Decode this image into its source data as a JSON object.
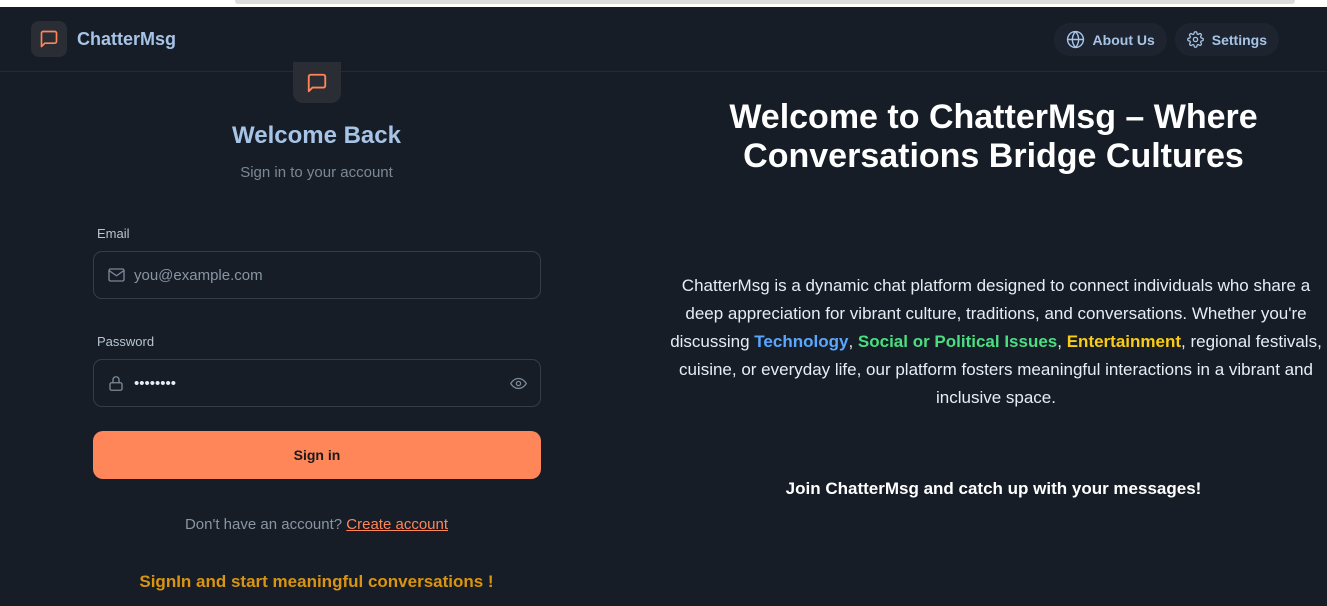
{
  "brand": {
    "name": "ChatterMsg",
    "icon": "chat-bubble-icon",
    "accent": "#fe8659"
  },
  "nav": {
    "about_label": "About Us",
    "about_icon": "globe-icon",
    "settings_label": "Settings",
    "settings_icon": "gear-icon"
  },
  "login": {
    "title": "Welcome Back",
    "subtitle": "Sign in to your account",
    "email_label": "Email",
    "email_placeholder": "you@example.com",
    "password_label": "Password",
    "password_value": "••••••••",
    "signin_label": "Sign in",
    "no_account_text": "Don't have an account?",
    "create_account_link": "Create account",
    "tagline": "SignIn and start meaningful conversations !"
  },
  "info": {
    "title": "Welcome to ChatterMsg – Where Conversations Bridge Cultures",
    "intro": "ChatterMsg is a dynamic chat platform designed to connect individuals who share a deep appreciation for vibrant culture, traditions, and conversations. Whether you're discussing",
    "topic_technology": "Technology",
    "topic_social": "Social or Political Issues",
    "topic_entertainment": "Entertainment",
    "outro": ", regional festivals, cuisine, or everyday life, our platform fosters meaningful interactions in a vibrant and inclusive space.",
    "join": "Join ChatterMsg and catch up with your messages!",
    "colors": {
      "technology": "#5aa7ff",
      "social": "#4ade80",
      "entertainment": "#facc15"
    }
  }
}
